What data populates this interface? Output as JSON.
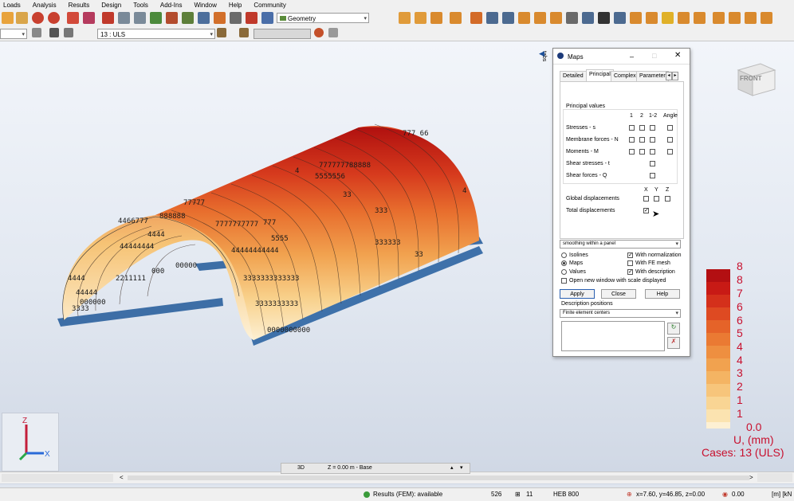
{
  "menu": [
    "Loads",
    "Analysis",
    "Results",
    "Design",
    "Tools",
    "Add-Ins",
    "Window",
    "Help",
    "Community"
  ],
  "toolbar": {
    "view_combo": "Geometry",
    "case_combo": "13 : ULS"
  },
  "viewcube_label": "FRONT",
  "tabs_label": "tabs",
  "legend": {
    "values": [
      "8",
      "8",
      "7",
      "6",
      "6",
      "5",
      "4",
      "4",
      "3",
      "2",
      "1",
      "1",
      "0.0"
    ],
    "colors": [
      "#b30f12",
      "#c81a15",
      "#d4301b",
      "#de4a22",
      "#e56329",
      "#ea7a33",
      "#ee8f40",
      "#f1a24f",
      "#f4b463",
      "#f7c57b",
      "#f9d594",
      "#fbe3b0",
      "#fdf0d3"
    ],
    "unit": "U, (mm)",
    "cases": "Cases: 13 (ULS)"
  },
  "dialog": {
    "title": "Maps",
    "tabs": [
      "Detailed",
      "Principal",
      "Complex",
      "Parameter"
    ],
    "group_title": "Principal values",
    "col_headers": [
      "1",
      "2",
      "1-2",
      "Angle"
    ],
    "rows": [
      "Stresses - s",
      "Membrane forces - N",
      "Moments - M",
      "Shear stresses - t",
      "Shear forces - Q"
    ],
    "disp_headers": [
      "X",
      "Y",
      "Z"
    ],
    "global_disp": "Global displacements",
    "total_disp": "Total displacements",
    "smoothing": "smoothing within a panel",
    "radio_isolines": "Isolines",
    "radio_maps": "Maps",
    "radio_values": "Values",
    "with_normalization": "With normalization",
    "with_fe_mesh": "With FE mesh",
    "with_description": "With description",
    "open_new_window": "Open new window with scale displayed",
    "apply": "Apply",
    "close": "Close",
    "help": "Help",
    "desc_positions": "Description positions",
    "desc_combo": "Finite element centers"
  },
  "bottom": {
    "view_3d": "3D",
    "level": "Z = 0.00 m - Base",
    "results": "Results (FEM): available",
    "node_count": "526",
    "case_no": "11",
    "section": "HEB 800",
    "coords": "x=7.60, y=46.85, z=0.00",
    "value": "0.00",
    "units": "[m] [kN"
  }
}
